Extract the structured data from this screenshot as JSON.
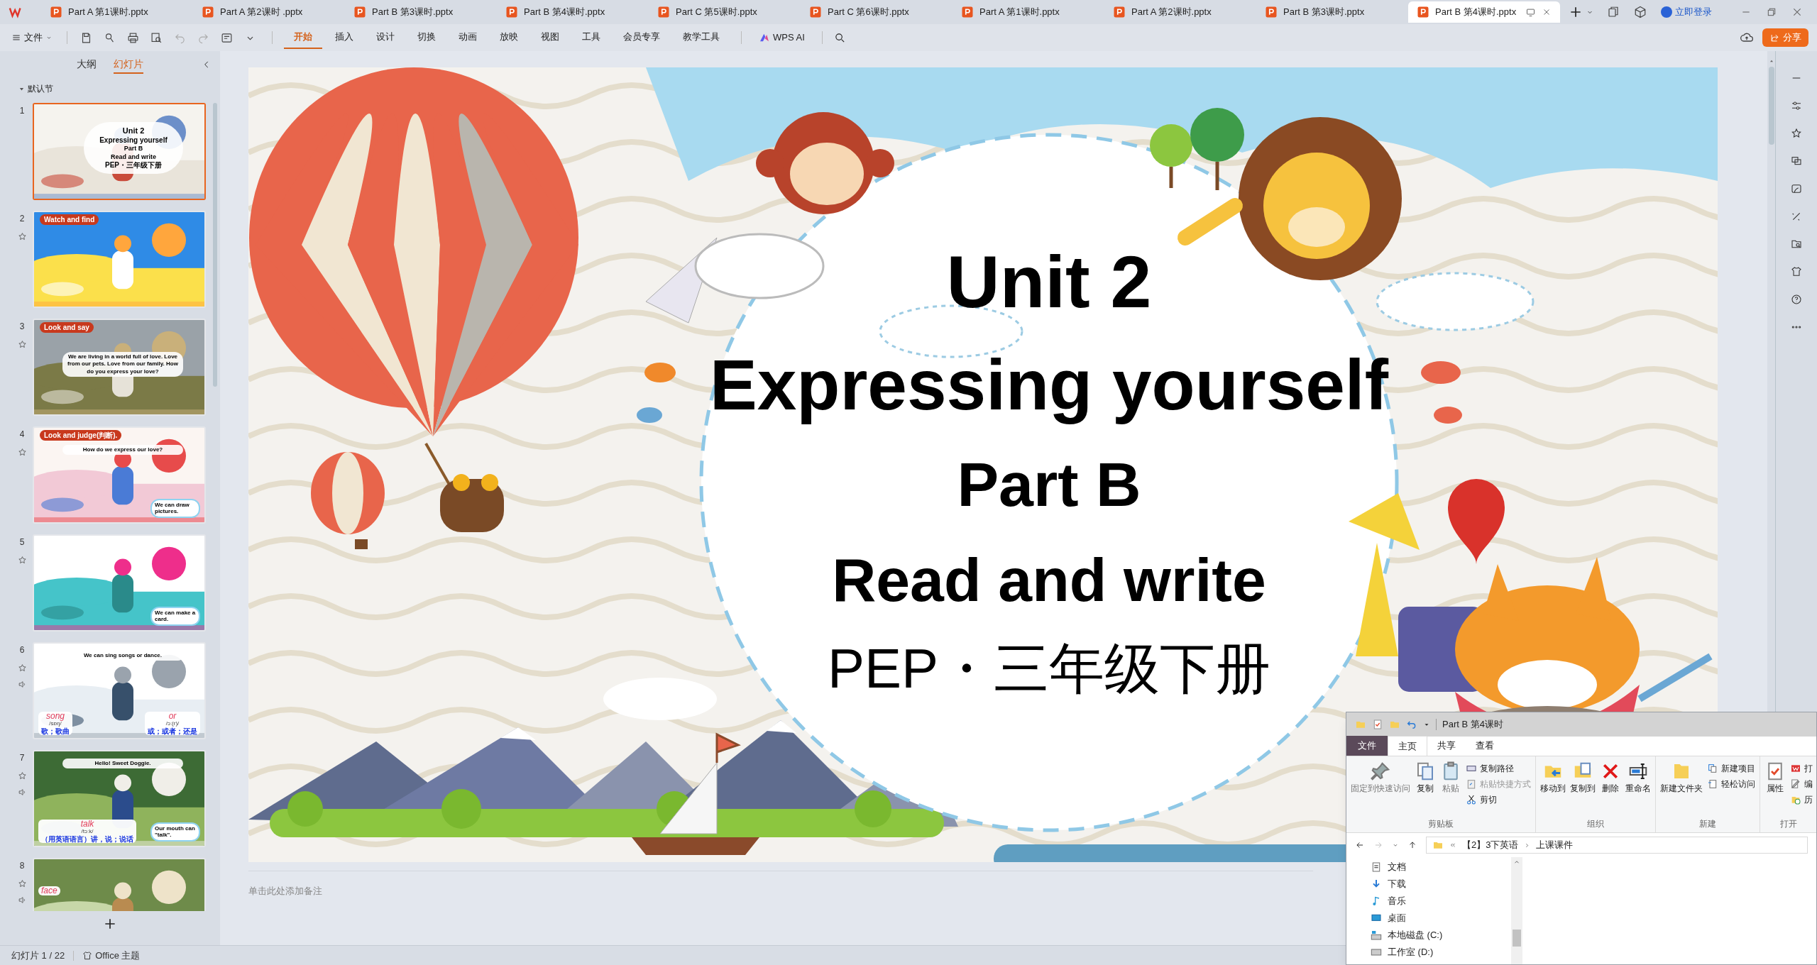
{
  "tabs": [
    {
      "label": "Part  A 第1课时.pptx",
      "selected": false
    },
    {
      "label": "Part  A 第2课时 .pptx",
      "selected": false
    },
    {
      "label": "Part  B 第3课时.pptx",
      "selected": false
    },
    {
      "label": "Part  B 第4课时.pptx",
      "selected": false
    },
    {
      "label": "Part  C 第5课时.pptx",
      "selected": false
    },
    {
      "label": "Part  C 第6课时.pptx",
      "selected": false
    },
    {
      "label": "Part  A 第1课时.pptx",
      "selected": false
    },
    {
      "label": "Part  A 第2课时.pptx",
      "selected": false
    },
    {
      "label": "Part  B 第3课时.pptx",
      "selected": false
    },
    {
      "label": "Part  B 第4课时.pptx",
      "selected": true
    }
  ],
  "account": {
    "login": "立即登录"
  },
  "menu": {
    "file": "文件",
    "ribbon_tabs": [
      {
        "label": "开始",
        "selected": true
      },
      {
        "label": "插入",
        "selected": false
      },
      {
        "label": "设计",
        "selected": false
      },
      {
        "label": "切换",
        "selected": false
      },
      {
        "label": "动画",
        "selected": false
      },
      {
        "label": "放映",
        "selected": false
      },
      {
        "label": "视图",
        "selected": false
      },
      {
        "label": "工具",
        "selected": false
      },
      {
        "label": "会员专享",
        "selected": false
      },
      {
        "label": "教学工具",
        "selected": false
      }
    ],
    "ai": "WPS AI",
    "share": "分享"
  },
  "panel": {
    "views": [
      {
        "label": "大纲",
        "selected": false
      },
      {
        "label": "幻灯片",
        "selected": true
      }
    ],
    "section": "默认节",
    "slides": [
      {
        "number": "1",
        "selected": true,
        "star": false,
        "audio": false,
        "kind": "title",
        "texts": [
          "Unit 2",
          "Expressing yourself",
          "Part B",
          "Read and write",
          "PEP・三年级下册"
        ]
      },
      {
        "number": "2",
        "selected": false,
        "star": true,
        "audio": false,
        "kind": "picture",
        "tag": "Watch and find"
      },
      {
        "number": "3",
        "selected": false,
        "star": true,
        "audio": false,
        "kind": "picture",
        "tag": "Look and say",
        "heading": "We are living in a world full of love. Love from our pets. Love from our family. How do you express your love?"
      },
      {
        "number": "4",
        "selected": false,
        "star": true,
        "audio": false,
        "kind": "picture",
        "tag": "Look and judge(判断).",
        "heading": "How do we express our love?",
        "bubble": "We can draw pictures."
      },
      {
        "number": "5",
        "selected": false,
        "star": true,
        "audio": false,
        "kind": "picture",
        "bubble": "We can make a card."
      },
      {
        "number": "6",
        "selected": false,
        "star": true,
        "audio": true,
        "kind": "picture",
        "heading": "We can sing songs or dance.",
        "cards": [
          {
            "word": "song",
            "phonetic": "/sɒŋ/",
            "meaning": "歌；歌曲"
          },
          {
            "word": "or",
            "phonetic": "/ɔː(r)/",
            "meaning": "或；或者；还是"
          }
        ]
      },
      {
        "number": "7",
        "selected": false,
        "star": true,
        "audio": true,
        "kind": "picture",
        "heading": "Hello! Sweet Doggie.",
        "bubble": "Our mouth can \"talk\".",
        "cards": [
          {
            "word": "talk",
            "phonetic": "/tɔːk/",
            "meaning": "（用英语语言）讲，说；说话"
          }
        ]
      },
      {
        "number": "8",
        "selected": false,
        "star": true,
        "audio": true,
        "kind": "picture",
        "cards": [
          {
            "word": "face"
          }
        ]
      }
    ]
  },
  "slide": {
    "texts": [
      "Unit 2",
      "Expressing yourself",
      "Part B",
      "Read and write",
      "PEP・三年级下册"
    ]
  },
  "notes": {
    "placeholder": "单击此处添加备注"
  },
  "status_bar": {
    "slide_count": "幻灯片 1 / 22",
    "theme": "Office 主题"
  },
  "explorer": {
    "title": "Part  B 第4课时",
    "tabs": [
      {
        "label": "文件",
        "selected": false
      },
      {
        "label": "主页",
        "selected": true
      },
      {
        "label": "共享",
        "selected": false
      },
      {
        "label": "查看",
        "selected": false
      }
    ],
    "groups": [
      {
        "label": "剪贴板",
        "big": [
          "固定到快速访问",
          "复制",
          "粘贴"
        ],
        "small": [
          "复制路径",
          "粘贴快捷方式",
          "剪切"
        ]
      },
      {
        "label": "组织",
        "big": [
          "移动到",
          "复制到",
          "删除",
          "重命名"
        ]
      },
      {
        "label": "新建",
        "big": [
          "新建文件夹"
        ],
        "small": [
          "新建项目",
          "轻松访问"
        ]
      },
      {
        "label": "打开",
        "big": [
          "属性"
        ],
        "small": [
          "打",
          "编",
          "历"
        ]
      }
    ],
    "path": [
      "【2】3下英语",
      "上课课件"
    ],
    "nav": [
      "文档",
      "下载",
      "音乐",
      "桌面",
      "本地磁盘 (C:)",
      "工作室 (D:)"
    ]
  }
}
